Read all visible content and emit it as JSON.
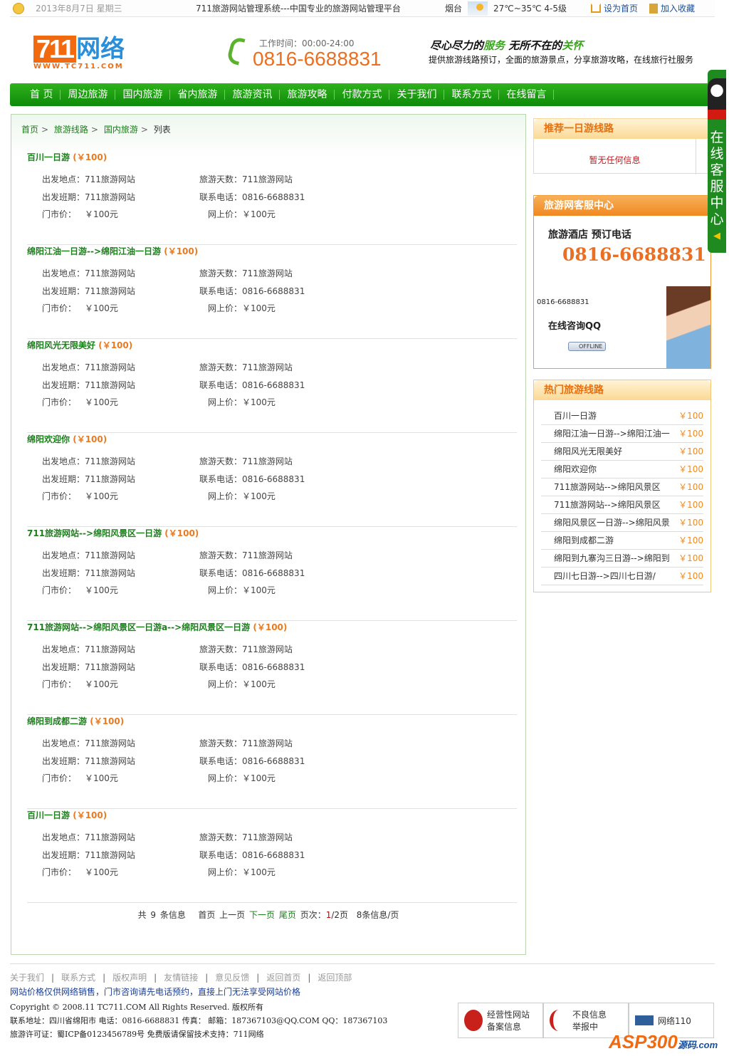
{
  "topbar": {
    "date": "2013年8月7日 星期三",
    "slogan": "711旅游网站管理系统---中国专业的旅游网站管理平台",
    "city": "烟台",
    "weather": "27℃~35℃ 4-5级",
    "set_home": "设为首页",
    "add_fav": "加入收藏"
  },
  "header": {
    "logo_num": "711",
    "logo_cn": "网络",
    "logo_url": "WWW.TC711.COM",
    "work_time": "工作时间：00:00-24:00",
    "hotline": "0816-6688831",
    "motto_a": "尽心尽力的",
    "motto_b": "服务",
    "motto_c": " 无所不在的",
    "motto_d": "关怀",
    "motto_sub": "提供旅游线路预订，全面的旅游景点，分享旅游攻略，在线旅行社服务"
  },
  "nav": [
    "首 页",
    "周边旅游",
    "国内旅游",
    "省内旅游",
    "旅游资讯",
    "旅游攻略",
    "付款方式",
    "关于我们",
    "联系方式",
    "在线留言"
  ],
  "breadcrumb": [
    "首页",
    "旅游线路",
    "国内旅游",
    "列表"
  ],
  "labels": {
    "depart": "出发地点：",
    "days": "旅游天数：",
    "schedule": "出发班期：",
    "phone": "联系电话：",
    "market": "门市价：",
    "online": "网上价："
  },
  "items": [
    {
      "title": "百川一日游",
      "price": "(￥100)",
      "depart": "711旅游网站",
      "days": "711旅游网站",
      "schedule": "711旅游网站",
      "phone": "0816-6688831",
      "market": "￥100元",
      "online": "￥100元"
    },
    {
      "title": "绵阳江油一日游-->绵阳江油一日游",
      "price": "(￥100)",
      "depart": "711旅游网站",
      "days": "711旅游网站",
      "schedule": "711旅游网站",
      "phone": "0816-6688831",
      "market": "￥100元",
      "online": "￥100元"
    },
    {
      "title": "绵阳风光无限美好",
      "price": "(￥100)",
      "depart": "711旅游网站",
      "days": "711旅游网站",
      "schedule": "711旅游网站",
      "phone": "0816-6688831",
      "market": "￥100元",
      "online": "￥100元"
    },
    {
      "title": "绵阳欢迎你",
      "price": "(￥100)",
      "depart": "711旅游网站",
      "days": "711旅游网站",
      "schedule": "711旅游网站",
      "phone": "0816-6688831",
      "market": "￥100元",
      "online": "￥100元"
    },
    {
      "title": "711旅游网站-->绵阳风景区一日游",
      "price": "(￥100)",
      "depart": "711旅游网站",
      "days": "711旅游网站",
      "schedule": "711旅游网站",
      "phone": "0816-6688831",
      "market": "￥100元",
      "online": "￥100元"
    },
    {
      "title": "711旅游网站-->绵阳风景区一日游a-->绵阳风景区一日游",
      "price": "(￥100)",
      "depart": "711旅游网站",
      "days": "711旅游网站",
      "schedule": "711旅游网站",
      "phone": "0816-6688831",
      "market": "￥100元",
      "online": "￥100元"
    },
    {
      "title": "绵阳到成都二游",
      "price": "(￥100)",
      "depart": "711旅游网站",
      "days": "711旅游网站",
      "schedule": "711旅游网站",
      "phone": "0816-6688831",
      "market": "￥100元",
      "online": "￥100元"
    },
    {
      "title": "百川一日游",
      "price": "(￥100)",
      "depart": "711旅游网站",
      "days": "711旅游网站",
      "schedule": "711旅游网站",
      "phone": "0816-6688831",
      "market": "￥100元",
      "online": "￥100元"
    }
  ],
  "pager": {
    "total": "共 9 条信息",
    "first": "首页",
    "prev": "上一页",
    "next": "下一页",
    "last": "尾页",
    "page_label": "页次：",
    "current": "1",
    "of": "/2页",
    "per_page": "8条信息/页"
  },
  "sidebar": {
    "recommend_title": "推荐一日游线路",
    "recommend_empty": "暂无任何信息",
    "service_title": "旅游网客服中心",
    "service_label": "旅游酒店  预订电话",
    "service_phone": "0816-6688831",
    "service_phone_small": "0816-6688831",
    "qq_label": "在线咨询QQ",
    "qq_status": "OFFLINE",
    "hot_title": "热门旅游线路",
    "hot": [
      {
        "name": "百川一日游",
        "price": "￥100"
      },
      {
        "name": "绵阳江油一日游-->绵阳江油一",
        "price": "￥100"
      },
      {
        "name": "绵阳风光无限美好",
        "price": "￥100"
      },
      {
        "name": "绵阳欢迎你",
        "price": "￥100"
      },
      {
        "name": "711旅游网站-->绵阳风景区",
        "price": "￥100"
      },
      {
        "name": "711旅游网站-->绵阳风景区",
        "price": "￥100"
      },
      {
        "name": "绵阳风景区一日游-->绵阳风景",
        "price": "￥100"
      },
      {
        "name": "绵阳到成都二游",
        "price": "￥100"
      },
      {
        "name": "绵阳到九寨沟三日游-->绵阳到",
        "price": "￥100"
      },
      {
        "name": "四川七日游-->四川七日游/",
        "price": "￥100"
      }
    ]
  },
  "float_tab": [
    "在",
    "线",
    "客",
    "服",
    "中",
    "心"
  ],
  "footer": {
    "links": [
      "关于我们",
      "联系方式",
      "版权声明",
      "友情链接",
      "意见反馈",
      "返回首页",
      "返回顶部"
    ],
    "note": "网站价格仅供网络销售，门市咨询请先电话预约，直接上门无法享受网站价格",
    "copyright": "Copyright © 2008.11 TC711.COM  All Rights Reserved.  版权所有",
    "contact": "联系地址：四川省绵阳市  电话：0816-6688831  传真：  邮箱：187367103@QQ.COM  QQ：187367103",
    "license": "旅游许可证：蜀ICP备0123456789号 免费版请保留技术支持：711网络",
    "badges": [
      "经营性网站备案信息",
      "不良信息举报中",
      "网络110"
    ],
    "watermark": "ASP300",
    "watermark_sub": "源码.com"
  }
}
